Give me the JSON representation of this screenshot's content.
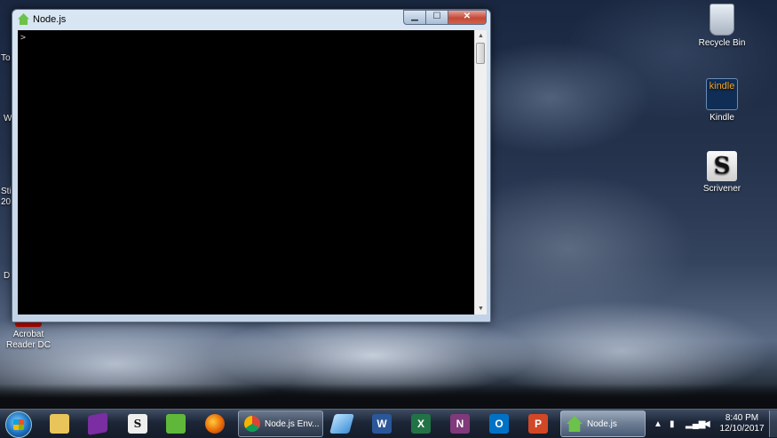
{
  "desktop": {
    "icons": {
      "recycle_bin": "Recycle Bin",
      "kindle": "Kindle",
      "kindle_logo": "kindle",
      "scrivener": "Scrivener",
      "acrobat_line1": "Acrobat",
      "acrobat_line2": "Reader DC"
    },
    "left_fragments": [
      "To",
      "W",
      "Sti",
      "20",
      "D"
    ]
  },
  "window": {
    "title": "Node.js",
    "prompt": ">",
    "minimize": "▁",
    "maximize": "☐",
    "close": "✕"
  },
  "taskbar": {
    "pinned": [
      {
        "name": "file-explorer",
        "color": "#e8c45a"
      },
      {
        "name": "onenote-notebook",
        "color": "#7a2ea1"
      },
      {
        "name": "scrivener",
        "color": "#eeeeee"
      },
      {
        "name": "evernote",
        "color": "#5fb83a"
      },
      {
        "name": "firefox",
        "color": "#e66000"
      }
    ],
    "chrome_button_label": "Node.js Env...",
    "pinned_right": [
      {
        "name": "mail",
        "color": "#3c8fd6",
        "glyph": ""
      },
      {
        "name": "word",
        "color": "#2b579a",
        "glyph": "W"
      },
      {
        "name": "excel",
        "color": "#217346",
        "glyph": "X"
      },
      {
        "name": "onenote",
        "color": "#80397b",
        "glyph": "N"
      },
      {
        "name": "outlook",
        "color": "#0072c6",
        "glyph": "O"
      },
      {
        "name": "powerpoint",
        "color": "#d24726",
        "glyph": "P"
      }
    ],
    "node_button_label": "Node.js",
    "tray": {
      "show_hidden": "▲",
      "time": "8:40 PM",
      "date": "12/10/2017"
    }
  }
}
